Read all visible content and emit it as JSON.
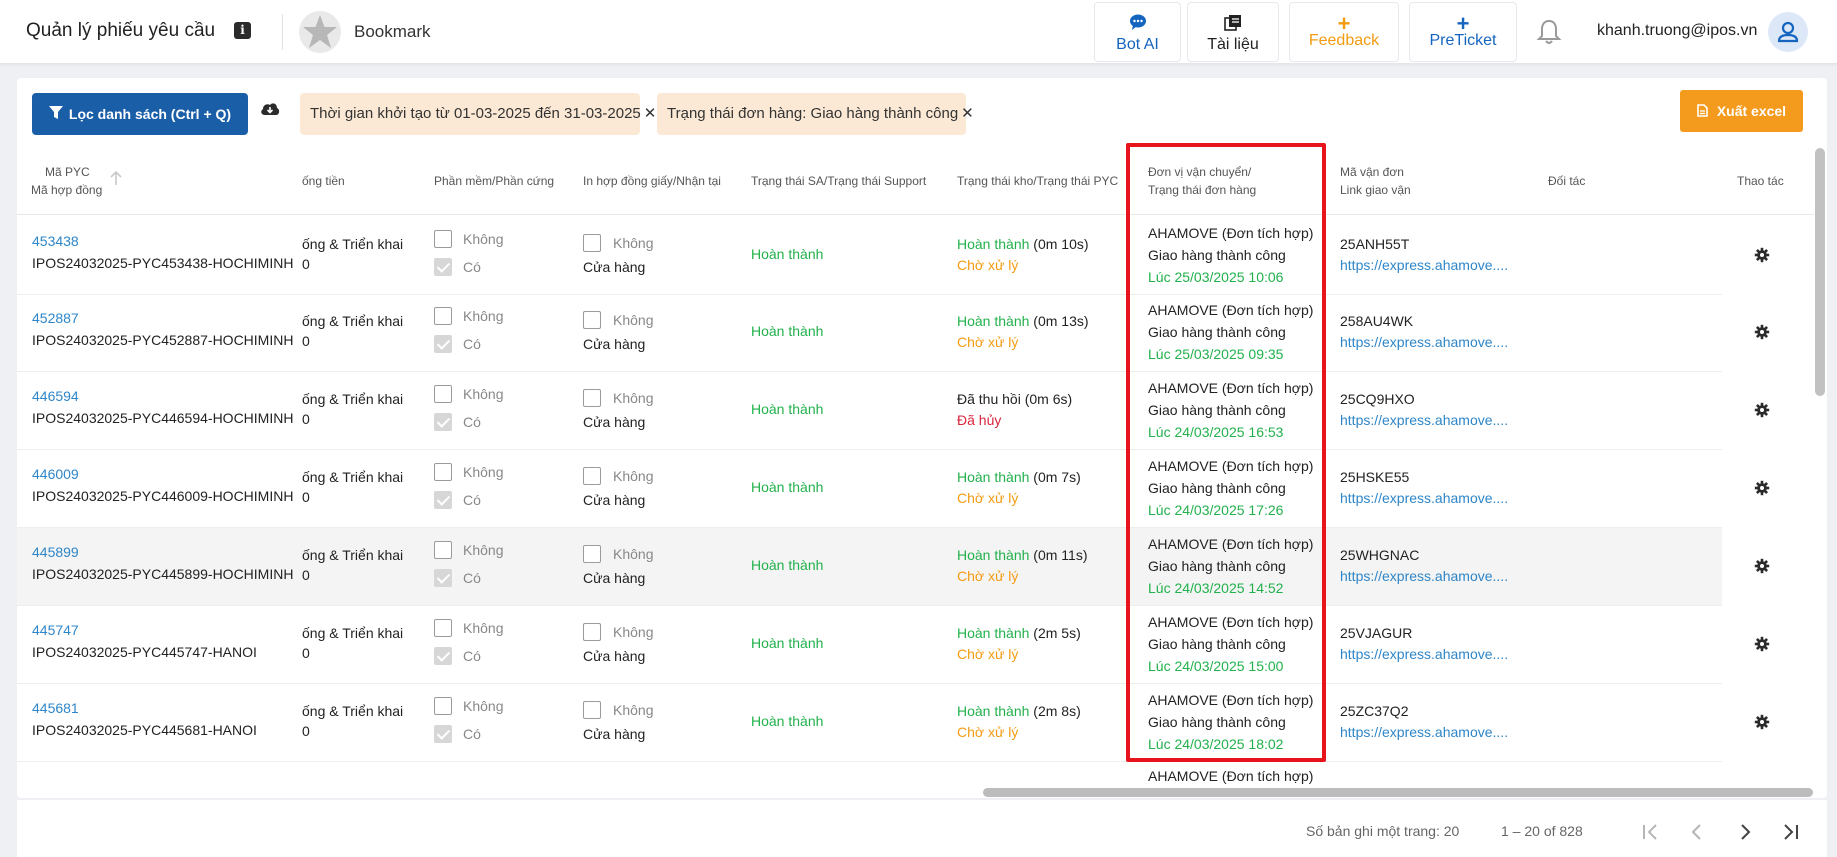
{
  "header": {
    "app_title": "Quản lý phiếu yêu cầu",
    "info_icon": "i",
    "bookmark_label": "Bookmark",
    "buttons": {
      "bot_ai": "Bot AI",
      "tai_lieu": "Tài liệu",
      "feedback": "Feedback",
      "preticket": "PreTicket"
    },
    "plus_glyph": "+",
    "user_email": "khanh.truong@ipos.vn"
  },
  "toolbar": {
    "filter_button": "Lọc danh sách (Ctrl + Q)",
    "chips": [
      "Thời gian khởi tạo từ 01-03-2025 đến 31-03-2025",
      "Trạng thái đơn hàng: Giao hàng thành công"
    ],
    "chip_close": "✕",
    "excel_button": "Xuất excel"
  },
  "table": {
    "headers": {
      "ma_pyc": "Mã PYC",
      "ma_hop_dong": "Mã hợp đồng",
      "thu_tien": "ống tiền",
      "phan_mem": "Phần mềm/Phần cứng",
      "in_hop_dong": "In hợp đồng giấy/Nhận tại",
      "trang_thai_sa": "Trạng thái SA/Trạng thái Support",
      "trang_thai_kho": "Trạng thái kho/Trạng thái PYC",
      "don_vi": "Đơn vị vận chuyển/",
      "trang_thai_don": "Trạng thái đơn hàng",
      "ma_van_don": "Mã vận đơn",
      "link_giao_van": "Link giao vận",
      "doi_tac": "Đối tác",
      "thao_tac": "Thao tác"
    },
    "labels": {
      "khong": "Không",
      "co": "Có",
      "cua_hang": "Cửa hàng"
    },
    "rows": [
      {
        "id": "453438",
        "contract": "IPOS24032025-PYC453438-HOCHIMINH",
        "service": "ống & Triển khai",
        "service2": "0",
        "sa": "Hoàn thành",
        "kho_status": "Hoàn thành",
        "kho_time": "(0m 10s)",
        "pyc": "Chờ xử lý",
        "carrier": "AHAMOVE (Đơn tích hợp)",
        "delivery": "Giao hàng thành công",
        "time": "Lúc 25/03/2025 10:06",
        "tracking": "25ANH55T",
        "link": "https://express.ahamove...."
      },
      {
        "id": "452887",
        "contract": "IPOS24032025-PYC452887-HOCHIMINH",
        "service": "ống & Triển khai",
        "service2": "0",
        "sa": "Hoàn thành",
        "kho_status": "Hoàn thành",
        "kho_time": "(0m 13s)",
        "pyc": "Chờ xử lý",
        "carrier": "AHAMOVE (Đơn tích hợp)",
        "delivery": "Giao hàng thành công",
        "time": "Lúc 25/03/2025 09:35",
        "tracking": "258AU4WK",
        "link": "https://express.ahamove...."
      },
      {
        "id": "446594",
        "contract": "IPOS24032025-PYC446594-HOCHIMINH",
        "service": "ống & Triển khai",
        "service2": "0",
        "sa": "Hoàn thành",
        "kho_status": "Đã thu hồi",
        "kho_time": "(0m 6s)",
        "pyc": "Đã hủy",
        "carrier": "AHAMOVE (Đơn tích hợp)",
        "delivery": "Giao hàng thành công",
        "time": "Lúc 24/03/2025 16:53",
        "tracking": "25CQ9HXO",
        "link": "https://express.ahamove...."
      },
      {
        "id": "446009",
        "contract": "IPOS24032025-PYC446009-HOCHIMINH",
        "service": "ống & Triển khai",
        "service2": "0",
        "sa": "Hoàn thành",
        "kho_status": "Hoàn thành",
        "kho_time": "(0m 7s)",
        "pyc": "Chờ xử lý",
        "carrier": "AHAMOVE (Đơn tích hợp)",
        "delivery": "Giao hàng thành công",
        "time": "Lúc 24/03/2025 17:26",
        "tracking": "25HSKE55",
        "link": "https://express.ahamove...."
      },
      {
        "id": "445899",
        "contract": "IPOS24032025-PYC445899-HOCHIMINH",
        "service": "ống & Triển khai",
        "service2": "0",
        "sa": "Hoàn thành",
        "kho_status": "Hoàn thành",
        "kho_time": "(0m 11s)",
        "pyc": "Chờ xử lý",
        "carrier": "AHAMOVE (Đơn tích hợp)",
        "delivery": "Giao hàng thành công",
        "time": "Lúc 24/03/2025 14:52",
        "tracking": "25WHGNAC",
        "link": "https://express.ahamove...."
      },
      {
        "id": "445747",
        "contract": "IPOS24032025-PYC445747-HANOI",
        "service": "ống & Triển khai",
        "service2": "0",
        "sa": "Hoàn thành",
        "kho_status": "Hoàn thành",
        "kho_time": "(2m 5s)",
        "pyc": "Chờ xử lý",
        "carrier": "AHAMOVE (Đơn tích hợp)",
        "delivery": "Giao hàng thành công",
        "time": "Lúc 24/03/2025 15:00",
        "tracking": "25VJAGUR",
        "link": "https://express.ahamove...."
      },
      {
        "id": "445681",
        "contract": "IPOS24032025-PYC445681-HANOI",
        "service": "ống & Triển khai",
        "service2": "0",
        "sa": "Hoàn thành",
        "kho_status": "Hoàn thành",
        "kho_time": "(2m 8s)",
        "pyc": "Chờ xử lý",
        "carrier": "AHAMOVE (Đơn tích hợp)",
        "delivery": "Giao hàng thành công",
        "time": "Lúc 24/03/2025 18:02",
        "tracking": "25ZC37Q2",
        "link": "https://express.ahamove...."
      }
    ],
    "partial_row": {
      "carrier": "AHAMOVE (Đơn tích hợp)"
    }
  },
  "pagination": {
    "per_page_label": "Số bản ghi một trang: 20",
    "range": "1 – 20 of 828"
  },
  "colors": {
    "primary": "#1b5ea8",
    "excel": "#f49b1e",
    "success": "#22b14c",
    "pending": "#f39c12",
    "cancelled": "#d9263d",
    "highlight_box": "#e8141c"
  }
}
